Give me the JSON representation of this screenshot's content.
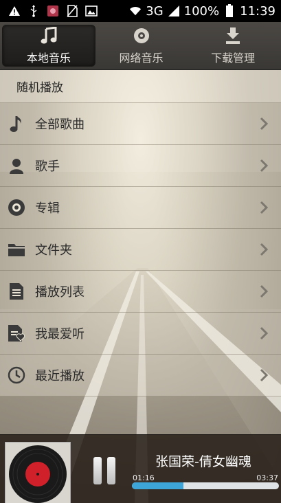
{
  "status_bar": {
    "network": "3G",
    "battery": "100%",
    "time": "11:39",
    "left_icons": [
      "warning-icon",
      "usb-icon",
      "app-notification-icon",
      "no-sim-icon",
      "image-icon"
    ]
  },
  "tabs": [
    {
      "label": "本地音乐",
      "icon": "music-note-icon",
      "active": true
    },
    {
      "label": "网络音乐",
      "icon": "disc-icon",
      "active": false
    },
    {
      "label": "下载管理",
      "icon": "download-icon",
      "active": false
    }
  ],
  "shuffle_label": "随机播放",
  "menu": [
    {
      "label": "全部歌曲",
      "icon": "music-note-icon"
    },
    {
      "label": "歌手",
      "icon": "person-icon"
    },
    {
      "label": "专辑",
      "icon": "album-icon"
    },
    {
      "label": "文件夹",
      "icon": "folder-icon"
    },
    {
      "label": "播放列表",
      "icon": "playlist-icon"
    },
    {
      "label": "我最爱听",
      "icon": "favorite-list-icon"
    },
    {
      "label": "最近播放",
      "icon": "clock-icon"
    }
  ],
  "player": {
    "song_title": "张国荣-倩女幽魂",
    "elapsed": "01:16",
    "total": "03:37",
    "progress": 0.35
  },
  "colors": {
    "progress_fill": "#3ea5d8",
    "tab_bar": "#45423e"
  }
}
